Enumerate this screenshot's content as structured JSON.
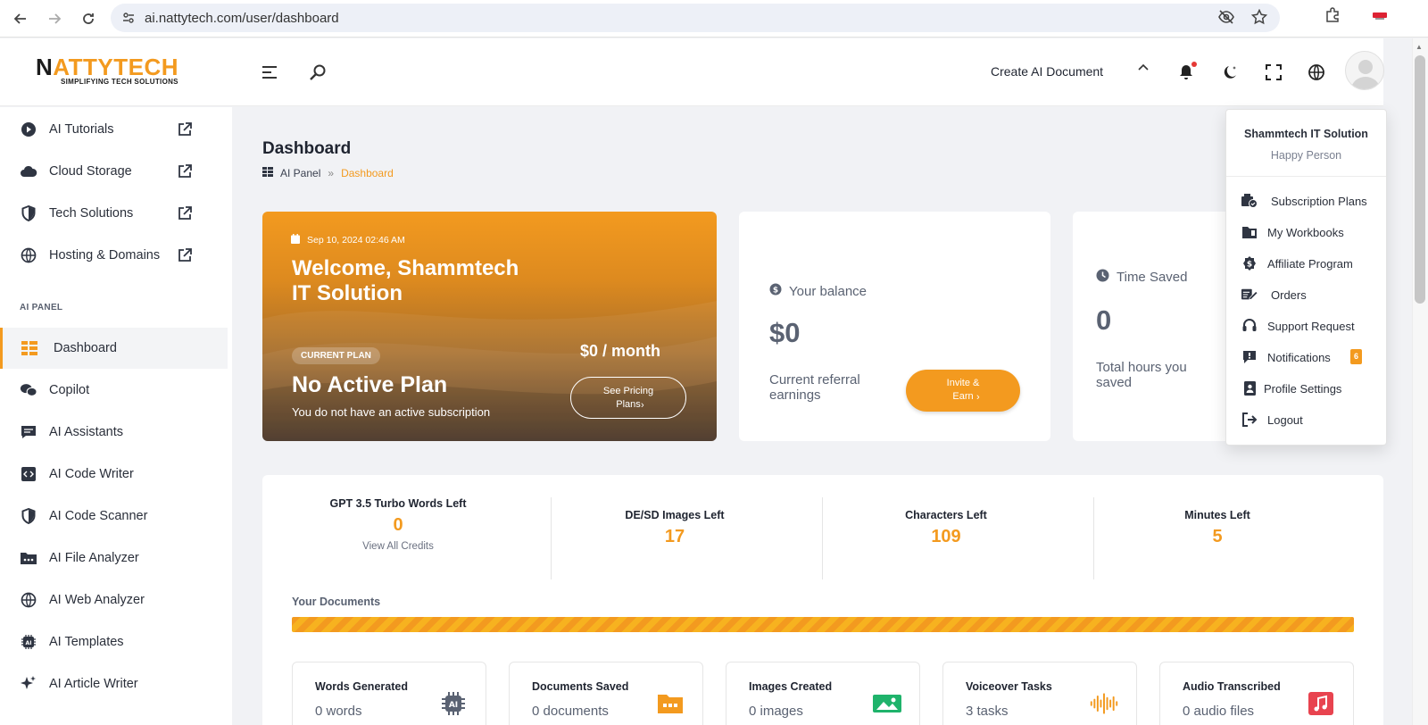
{
  "browser": {
    "url": "ai.nattytech.com/user/dashboard"
  },
  "logo": {
    "name_orange": "ATTYTECH",
    "name_dark": "N",
    "tagline": "SIMPLIFYING TECH SOLUTIONS"
  },
  "header": {
    "create_doc_label": "Create AI Document"
  },
  "sidebar": {
    "top_items": [
      {
        "label": "AI Tutorials",
        "icon": "play-circle-icon"
      },
      {
        "label": "Cloud Storage",
        "icon": "cloud-icon"
      },
      {
        "label": "Tech Solutions",
        "icon": "shield-icon"
      },
      {
        "label": "Hosting & Domains",
        "icon": "globe-icon"
      }
    ],
    "section_label": "AI PANEL",
    "panel_items": [
      {
        "label": "Dashboard",
        "icon": "grid-icon",
        "active": true
      },
      {
        "label": "Copilot",
        "icon": "chat-icon"
      },
      {
        "label": "AI Assistants",
        "icon": "assistant-icon"
      },
      {
        "label": "AI Code Writer",
        "icon": "code-icon"
      },
      {
        "label": "AI Code Scanner",
        "icon": "shield-half-icon"
      },
      {
        "label": "AI File Analyzer",
        "icon": "folder-icon"
      },
      {
        "label": "AI Web Analyzer",
        "icon": "globe-icon"
      },
      {
        "label": "AI Templates",
        "icon": "ai-chip-icon"
      },
      {
        "label": "AI Article Writer",
        "icon": "sparkle-icon"
      }
    ]
  },
  "page": {
    "title": "Dashboard",
    "breadcrumb": {
      "root": "AI Panel",
      "sep": "»",
      "current": "Dashboard"
    }
  },
  "welcome": {
    "date": "Sep 10, 2024 02:46 AM",
    "title": "Welcome, Shammtech IT Solution",
    "plan_tag": "CURRENT PLAN",
    "plan_name": "No Active Plan",
    "plan_sub": "You do not have an active subscription",
    "price": "$0 / month",
    "pricing_button": "See Pricing Plans"
  },
  "balance": {
    "label": "Your balance",
    "value": "$0",
    "sub": "Current referral earnings",
    "invite_button": "Invite & Earn"
  },
  "time_saved": {
    "label": "Time Saved",
    "value": "0",
    "sub": "Total hours you saved"
  },
  "credits": [
    {
      "label": "GPT 3.5 Turbo Words Left",
      "value": "0",
      "extra": "View All Credits"
    },
    {
      "label": "DE/SD Images Left",
      "value": "17"
    },
    {
      "label": "Characters Left",
      "value": "109"
    },
    {
      "label": "Minutes Left",
      "value": "5"
    }
  ],
  "documents": {
    "title": "Your Documents",
    "cards": [
      {
        "label": "Words Generated",
        "value": "0 words",
        "icon": "ai-chip-icon"
      },
      {
        "label": "Documents Saved",
        "value": "0 documents",
        "icon": "folder-icon"
      },
      {
        "label": "Images Created",
        "value": "0 images",
        "icon": "image-icon"
      },
      {
        "label": "Voiceover Tasks",
        "value": "3 tasks",
        "icon": "waveform-icon"
      },
      {
        "label": "Audio Transcribed",
        "value": "0 audio files",
        "icon": "music-icon"
      }
    ]
  },
  "user_menu": {
    "name": "Shammtech IT Solution",
    "role": "Happy Person",
    "items": [
      {
        "label": "Subscription Plans",
        "icon": "subscription-icon"
      },
      {
        "label": "My Workbooks",
        "icon": "workbook-icon"
      },
      {
        "label": "Affiliate Program",
        "icon": "dollar-badge-icon"
      },
      {
        "label": "Orders",
        "icon": "orders-icon"
      },
      {
        "label": "Support Request",
        "icon": "headset-icon"
      },
      {
        "label": "Notifications",
        "icon": "notification-icon",
        "badge": "6"
      },
      {
        "label": "Profile Settings",
        "icon": "id-card-icon"
      },
      {
        "label": "Logout",
        "icon": "logout-icon"
      }
    ]
  },
  "colors": {
    "accent": "#f39a1f",
    "text": "#1f2430",
    "muted": "#5a6272",
    "background": "#f1f2f5"
  }
}
